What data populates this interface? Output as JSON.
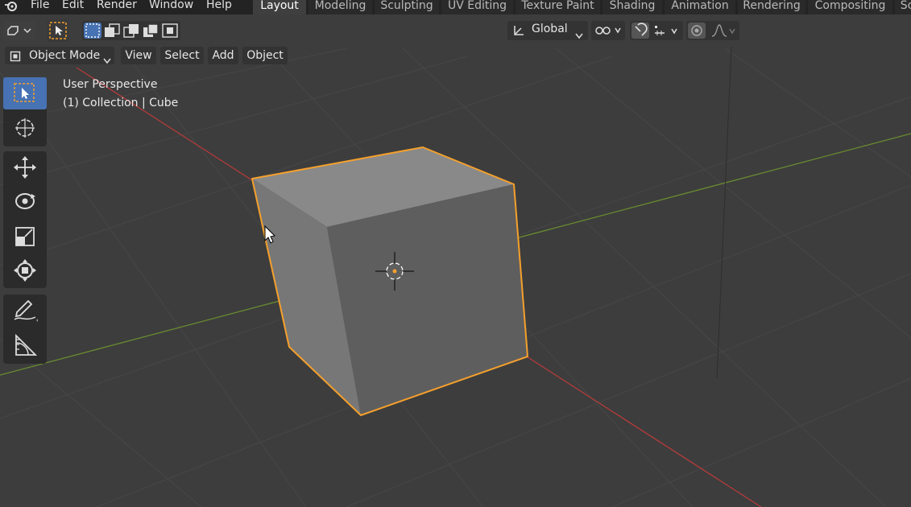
{
  "menu": {
    "items": [
      "File",
      "Edit",
      "Render",
      "Window",
      "Help"
    ]
  },
  "workspaces": {
    "tabs": [
      "Layout",
      "Modeling",
      "Sculpting",
      "UV Editing",
      "Texture Paint",
      "Shading",
      "Animation",
      "Rendering",
      "Compositing",
      "Sc"
    ],
    "active": "Layout"
  },
  "header": {
    "orientation_label": "Global"
  },
  "viewport_header": {
    "mode_label": "Object Mode",
    "menus": [
      "View",
      "Select",
      "Add",
      "Object"
    ]
  },
  "overlay": {
    "perspective_label": "User Perspective",
    "collection_label": "(1) Collection | Cube"
  },
  "toolbar": {
    "tools": [
      "select-box-tool",
      "cursor-tool",
      "move-tool",
      "rotate-tool",
      "scale-tool",
      "transform-tool",
      "annotate-tool",
      "measure-tool"
    ],
    "active_tool": "select-box-tool"
  },
  "colors": {
    "accent": "#4772b3",
    "selection_outline": "#f5a02c",
    "x_axis": "#b33b3b",
    "y_axis": "#6a8c2f",
    "background": "#3d3d3d"
  }
}
